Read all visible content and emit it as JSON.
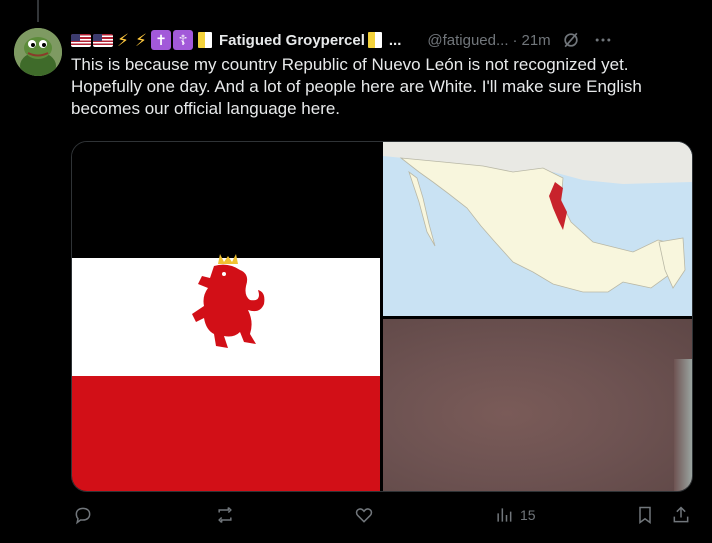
{
  "post": {
    "author_name": "Fatigued Groypercel",
    "name_overflow": "...",
    "handle": "@fatigued...",
    "separator": "·",
    "timestamp": "21m",
    "text": "This is because my country Republic of Nuevo León is not recognized yet. Hopefully one day. And a lot of people here are White. I'll make sure English becomes our official language here.",
    "name_emojis": [
      "us-flag",
      "us-flag",
      "lightning",
      "lightning",
      "latin-cross",
      "orthodox-cross",
      "vatican-flag"
    ],
    "badge_after_name": "vatican-flag"
  },
  "media": {
    "items": [
      "flag-image",
      "map-image",
      "photo-image"
    ],
    "flag_colors": {
      "top": "#000000",
      "middle": "#ffffff",
      "bottom": "#d20f17"
    },
    "map_highlight_color": "#c8232c"
  },
  "actions": {
    "reply_count": "",
    "repost_count": "",
    "like_count": "",
    "views_count": "15"
  },
  "icons": [
    "grok-icon",
    "more-icon",
    "reply-icon",
    "repost-icon",
    "like-icon",
    "views-icon",
    "bookmark-icon",
    "share-icon"
  ]
}
